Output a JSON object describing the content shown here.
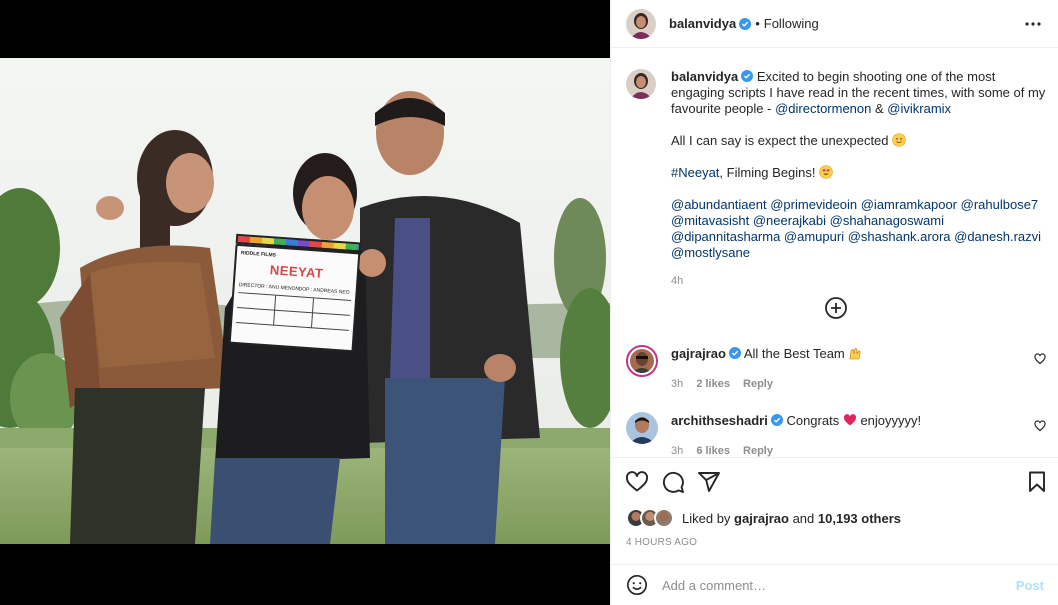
{
  "post": {
    "author": "balanvidya",
    "follow_dot": "•",
    "follow_status": "Following",
    "caption_author": "balanvidya",
    "caption_text_1": "Excited to begin shooting one of the most engaging scripts I have read in the recent times, with some of my favourite people - ",
    "mention_1": "@directormenon",
    "amp": " & ",
    "mention_2": "@ivikramix",
    "caption_text_2": "All I can say is expect the unexpected",
    "hashtag": "#Neeyat",
    "caption_text_3": ", Filming Begins!",
    "mentions_block": "@abundantiaent @primevideoin @iamramkapoor @rahulbose7 @mitavasisht @neerajkabi @shahanagoswami @dipannitasharma @amupuri @shashank.arora @danesh.razvi @mostlysane",
    "caption_time": "4h"
  },
  "clapper": {
    "studio": "RIDDLE FILMS",
    "title": "NEEYAT",
    "director": "DIRECTOR : ANU MENON",
    "dop": "DOP : ANDREAS NEO"
  },
  "comments": [
    {
      "user": "gajrajrao",
      "text": "All the Best Team",
      "time": "3h",
      "likes": "2 likes",
      "reply": "Reply"
    },
    {
      "user": "archithseshadri",
      "text": "Congrats",
      "text_after": "enjoyyyyy!",
      "time": "3h",
      "likes": "6 likes",
      "reply": "Reply"
    }
  ],
  "likes": {
    "prefix": "Liked by ",
    "user": "gajrajrao",
    "middle": " and ",
    "count": "10,193 others"
  },
  "date": "4 HOURS AGO",
  "add_comment": {
    "placeholder": "Add a comment…",
    "post_label": "Post"
  },
  "icons": {
    "more": "more-options-icon",
    "add": "load-more-icon",
    "like": "heart-icon",
    "comment": "comment-icon",
    "share": "share-icon",
    "save": "bookmark-icon",
    "emoji": "emoji-icon",
    "verified": "verified-badge-icon"
  },
  "colors": {
    "accent": "#0095f6",
    "link": "#00376b",
    "muted": "#8e8e8e",
    "verified": "#3897f0",
    "post_disabled": "#b2dffc"
  }
}
